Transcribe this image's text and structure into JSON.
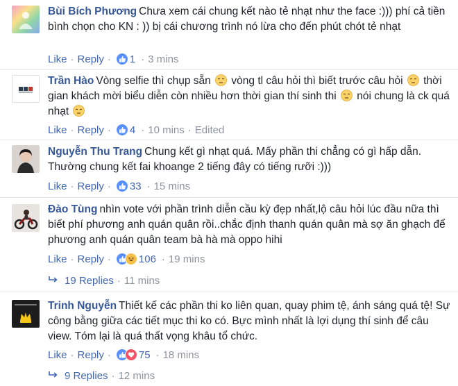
{
  "comments": [
    {
      "author": "Bùi Bích Phương",
      "text": "Chưa xem cái chung kết nào tẻ nhạt như the face :))) phí cả tiền bình chọn cho KN : )) bị cái chương trình nó lừa cho đến phút chót tẻ nhạt",
      "like": "Like",
      "reply": "Reply",
      "count": "1",
      "time": "3 mins",
      "edited": "",
      "reactions": [
        "like"
      ],
      "avatar": "rainbow-figure"
    },
    {
      "author": "Trần Hào",
      "text_parts": [
        "Vòng selfie thì chụp sẵn ",
        " vòng tl câu hỏi thì biết trước câu hỏi ",
        " thời gian khách mời biểu diễn còn nhiều hơn thời gian thí sinh thi ",
        " nói chung là ck quá nhạt "
      ],
      "like": "Like",
      "reply": "Reply",
      "count": "4",
      "time": "10 mins",
      "edited": "Edited",
      "reactions": [
        "like"
      ],
      "avatar": "logo-small"
    },
    {
      "author": "Nguyễn Thu Trang",
      "text": "Chung kết gì nhạt quá. Mấy phần thi chẳng có gì hấp dẫn. Thường chung kết fai khoange 2 tiếng đây có tiếng rưỡi :)))",
      "like": "Like",
      "reply": "Reply",
      "count": "33",
      "time": "15 mins",
      "edited": "",
      "reactions": [
        "like"
      ],
      "avatar": "woman-portrait"
    },
    {
      "author": "Đào Tùng",
      "text": "nhìn vote với phần trình diễn cầu kỳ đẹp nhất,lộ câu hỏi lúc đầu nữa thì biết phí phương anh quán quân rồi..chắc định thanh quán quân mà sợ ăn ghạch để phương anh quán quân team bà hà mà oppo hihi",
      "like": "Like",
      "reply": "Reply",
      "count": "106",
      "time": "19 mins",
      "edited": "",
      "reactions": [
        "like",
        "haha"
      ],
      "avatar": "motorbike",
      "replies_label": "19 Replies",
      "replies_time": "11 mins"
    },
    {
      "author": "Trinh Nguyễn",
      "text": "Thiết kế các phần thi ko liên quan, quay phim tệ, ánh sáng quá tệ! Sự công bằng giữa các tiết mục thi ko có. Bực mình nhất là lợi dụng thí sinh để câu view. Tóm lại là quá thất vọng khâu tổ chức.",
      "like": "Like",
      "reply": "Reply",
      "count": "75",
      "time": "18 mins",
      "edited": "",
      "reactions": [
        "like",
        "love"
      ],
      "avatar": "crown-logo",
      "replies_label": "9 Replies",
      "replies_time": "12 mins"
    }
  ],
  "separator": "·",
  "colors": {
    "link": "#4267b2",
    "author": "#365899",
    "meta": "#8d949e",
    "text": "#1d2129"
  }
}
